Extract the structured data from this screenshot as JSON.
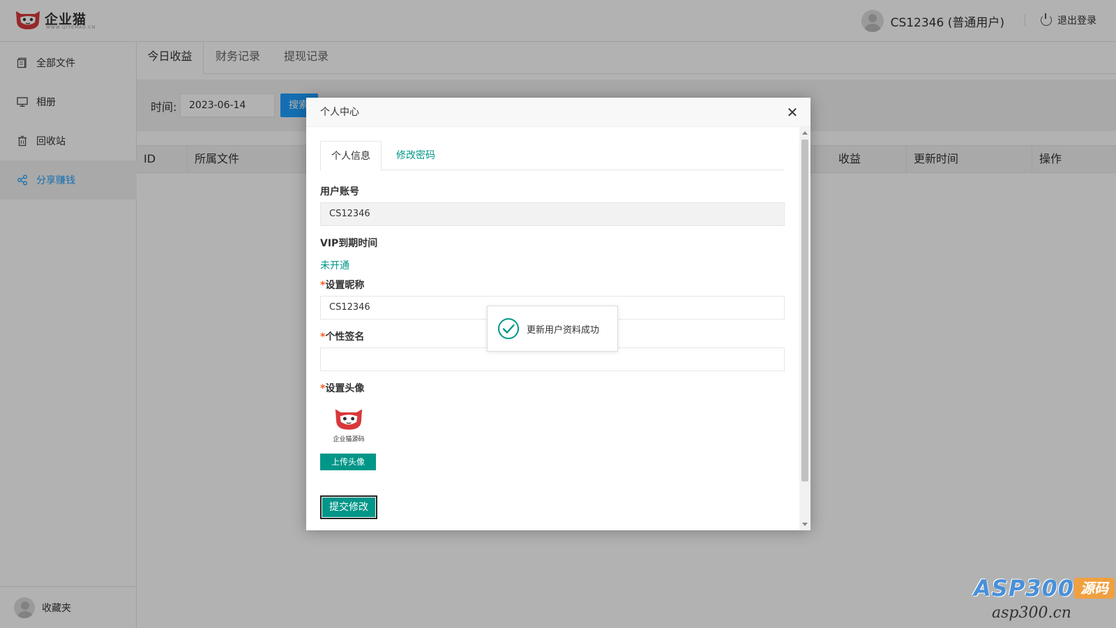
{
  "header": {
    "logo_text": "企业猫",
    "logo_sub": "WWW.QIYEMAO.CN",
    "user_name": "CS12346 (普通用户)",
    "logout_label": "退出登录"
  },
  "sidebar": {
    "items": [
      {
        "label": "全部文件",
        "icon": "file-icon"
      },
      {
        "label": "相册",
        "icon": "monitor-icon"
      },
      {
        "label": "回收站",
        "icon": "trash-icon"
      },
      {
        "label": "分享赚钱",
        "icon": "share-icon",
        "active": true
      }
    ],
    "bottom_label": "收藏夹"
  },
  "main": {
    "tabs": [
      "今日收益",
      "财务记录",
      "提现记录"
    ],
    "toolbar": {
      "time_label": "时间:",
      "date_value": "2023-06-14",
      "search_label": "搜索"
    },
    "table_headers": [
      "ID",
      "所属文件",
      "收益",
      "更新时间",
      "操作"
    ]
  },
  "modal": {
    "title": "个人中心",
    "tabs": [
      "个人信息",
      "修改密码"
    ],
    "account_label": "用户账号",
    "account_value": "CS12346",
    "vip_label": "VIP到期时间",
    "vip_value": "未开通",
    "nickname_label": "设置昵称",
    "nickname_value": "CS12346",
    "signature_label": "个性签名",
    "signature_value": "",
    "avatar_label": "设置头像",
    "avatar_caption": "企业猫源码",
    "upload_label": "上传头像",
    "submit_label": "提交修改",
    "required_mark": "*"
  },
  "toast": {
    "message": "更新用户资料成功"
  },
  "watermark": {
    "brand": "ASP300",
    "tag": "源码",
    "url": "asp300.cn"
  },
  "colors": {
    "accent_blue": "#1e9fff",
    "accent_green": "#009688",
    "required_red": "#ff5722"
  }
}
